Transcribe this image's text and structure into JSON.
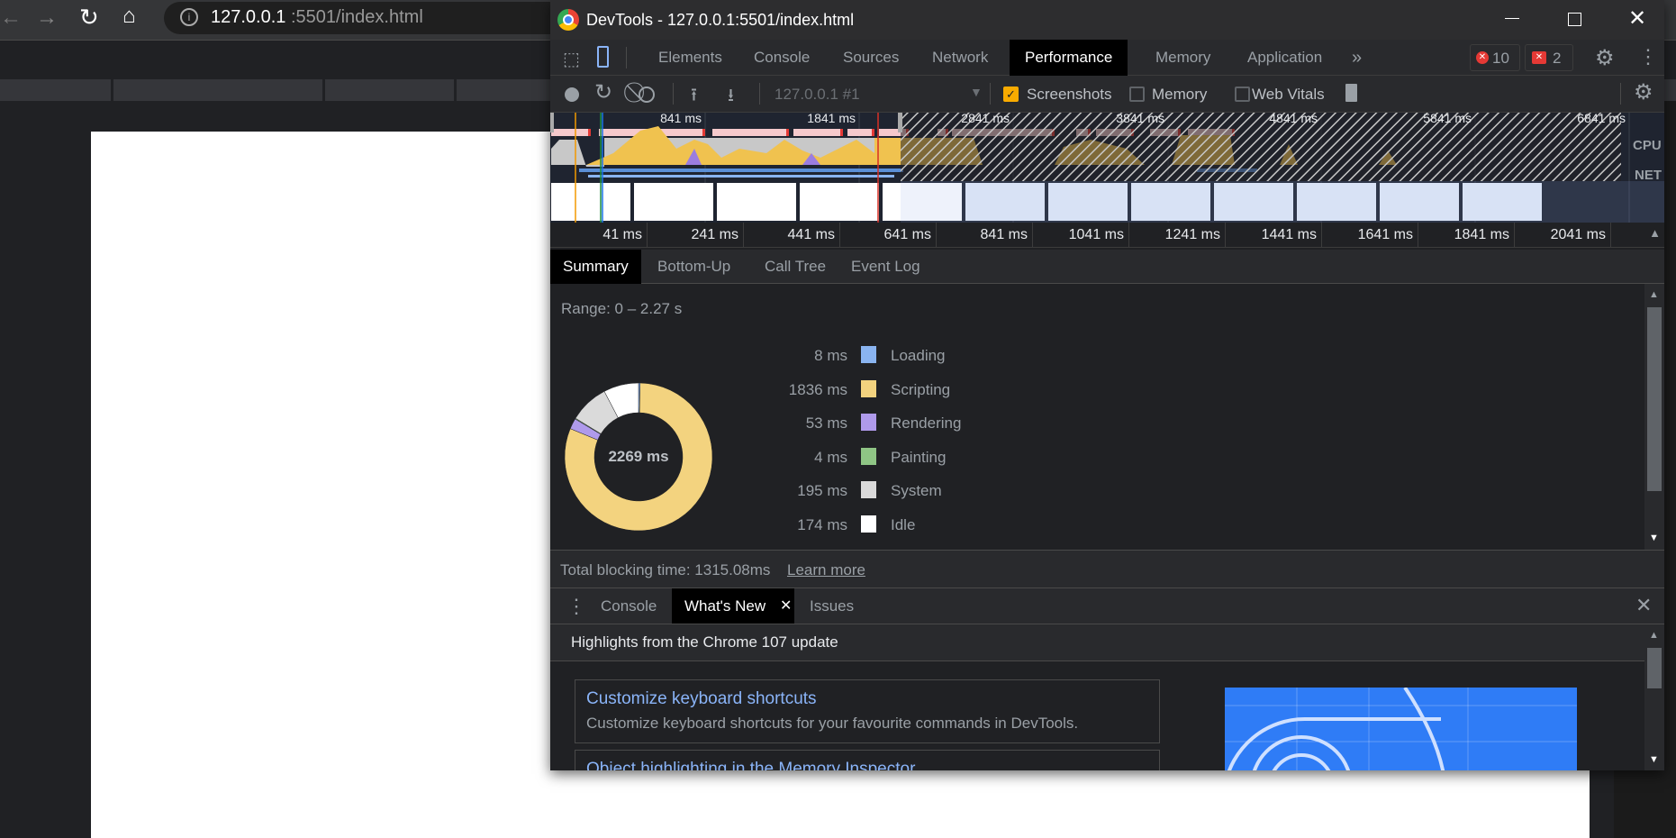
{
  "browser": {
    "url_host": "127.0.0.1",
    "url_rest": ":5501/index.html"
  },
  "devtools": {
    "window_title": "DevTools - 127.0.0.1:5501/index.html",
    "tabs": [
      {
        "label": "Elements"
      },
      {
        "label": "Console"
      },
      {
        "label": "Sources"
      },
      {
        "label": "Network"
      },
      {
        "label": "Performance",
        "active": true
      },
      {
        "label": "Memory"
      },
      {
        "label": "Application"
      }
    ],
    "more_tabs": "»",
    "error_count": "10",
    "issue_count": "2",
    "toolbar": {
      "profile_select": "127.0.0.1 #1",
      "screenshots_label": "Screenshots",
      "screenshots_checked": true,
      "memory_label": "Memory",
      "memory_checked": false,
      "web_vitals_label": "Web Vitals",
      "web_vitals_checked": false
    },
    "overview": {
      "ticks": [
        "841 ms",
        "1841 ms",
        "2841 ms",
        "3841 ms",
        "4841 ms",
        "5841 ms",
        "6841 ms"
      ],
      "cpu_label": "CPU",
      "net_label": "NET"
    },
    "ruler": {
      "ticks": [
        "41 ms",
        "241 ms",
        "441 ms",
        "641 ms",
        "841 ms",
        "1041 ms",
        "1241 ms",
        "1441 ms",
        "1641 ms",
        "1841 ms",
        "2041 ms"
      ]
    },
    "summary_tabs": [
      {
        "label": "Summary",
        "active": true
      },
      {
        "label": "Bottom-Up"
      },
      {
        "label": "Call Tree"
      },
      {
        "label": "Event Log"
      }
    ],
    "summary": {
      "range": "Range: 0 – 2.27 s",
      "total": "2269 ms",
      "items": [
        {
          "value": "8 ms",
          "ms": 8,
          "label": "Loading",
          "color": "#8ab4f0"
        },
        {
          "value": "1836 ms",
          "ms": 1836,
          "label": "Scripting",
          "color": "#f3d37f"
        },
        {
          "value": "53 ms",
          "ms": 53,
          "label": "Rendering",
          "color": "#af9aeb"
        },
        {
          "value": "4 ms",
          "ms": 4,
          "label": "Painting",
          "color": "#8fc585"
        },
        {
          "value": "195 ms",
          "ms": 195,
          "label": "System",
          "color": "#dadada"
        },
        {
          "value": "174 ms",
          "ms": 174,
          "label": "Idle",
          "color": "#ffffff"
        }
      ],
      "blocking": "Total blocking time: 1315.08ms",
      "learn_more": "Learn more"
    },
    "drawer": {
      "tabs": [
        {
          "label": "Console"
        },
        {
          "label": "What's New",
          "active": true
        },
        {
          "label": "Issues"
        }
      ],
      "heading": "Highlights from the Chrome 107 update",
      "cards": [
        {
          "title": "Customize keyboard shortcuts",
          "desc": "Customize keyboard shortcuts for your favourite commands in DevTools."
        },
        {
          "title": "Object highlighting in the Memory Inspector"
        }
      ]
    }
  }
}
